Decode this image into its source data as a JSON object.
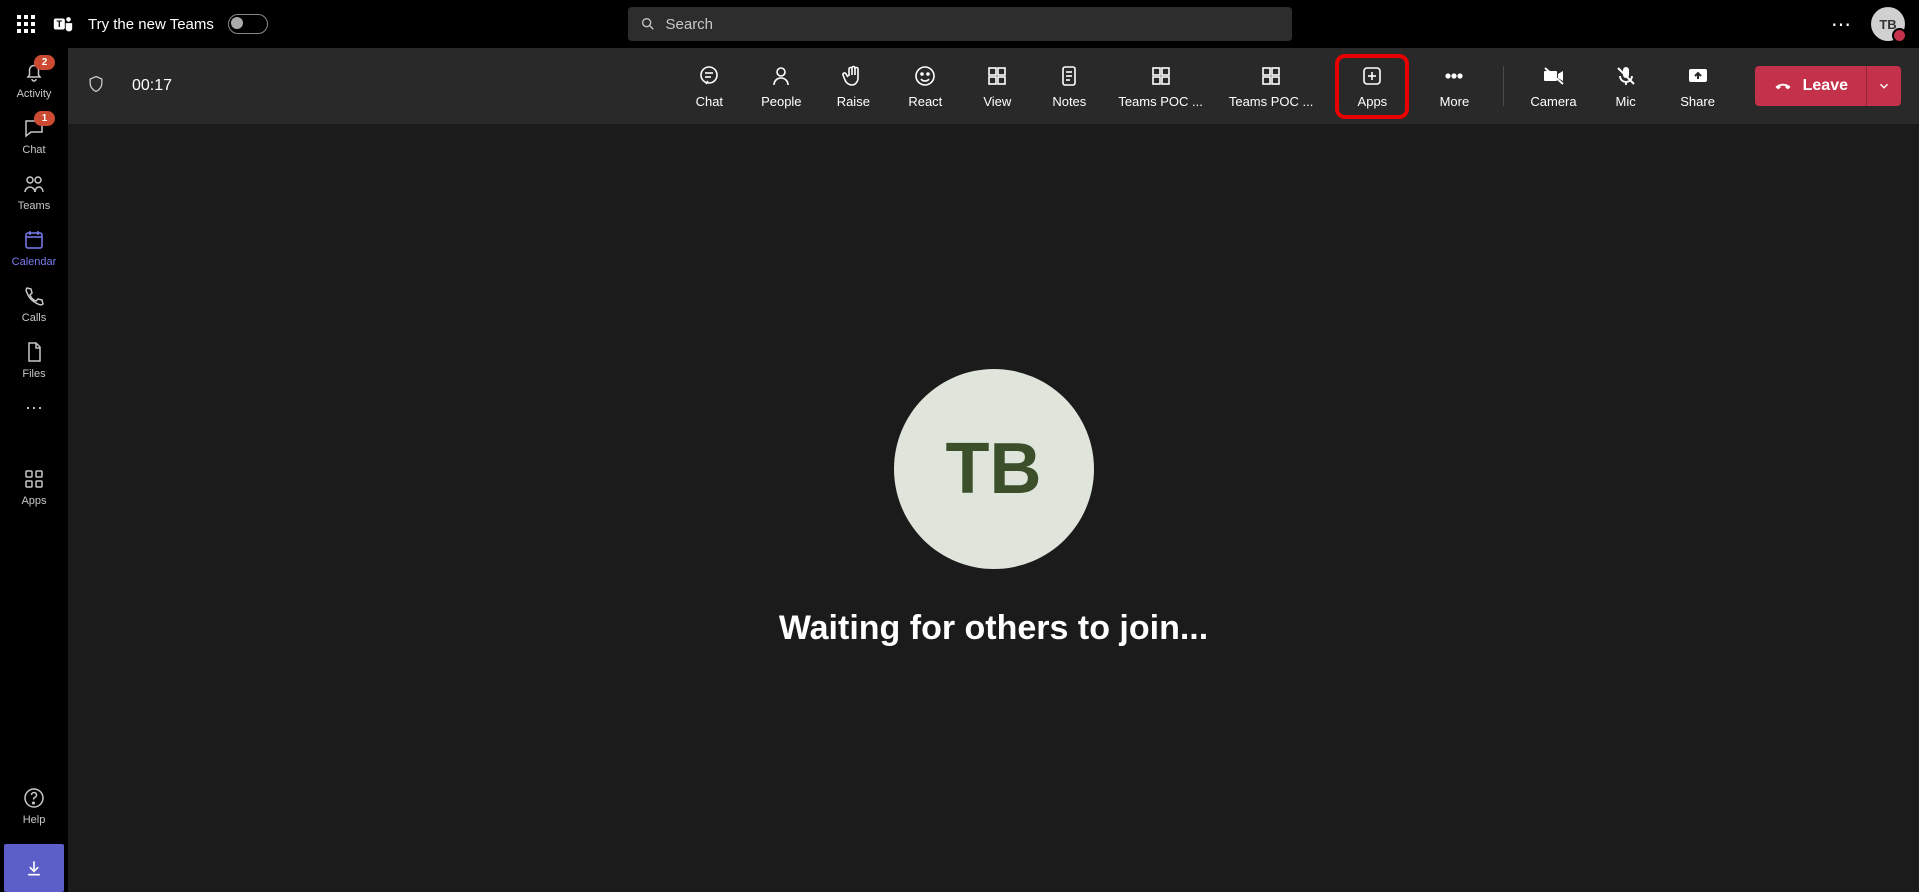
{
  "topbar": {
    "try_text": "Try the new Teams",
    "search_placeholder": "Search",
    "profile_initials": "TB"
  },
  "leftrail": {
    "items": [
      {
        "id": "activity",
        "label": "Activity",
        "badge": "2"
      },
      {
        "id": "chat",
        "label": "Chat",
        "badge": "1"
      },
      {
        "id": "teams",
        "label": "Teams"
      },
      {
        "id": "calendar",
        "label": "Calendar",
        "active": true
      },
      {
        "id": "calls",
        "label": "Calls"
      },
      {
        "id": "files",
        "label": "Files"
      }
    ],
    "apps_label": "Apps",
    "help_label": "Help"
  },
  "meetingbar": {
    "timer": "00:17",
    "buttons": {
      "chat": "Chat",
      "people": "People",
      "raise": "Raise",
      "react": "React",
      "view": "View",
      "notes": "Notes",
      "poc1": "Teams POC ...",
      "poc2": "Teams POC ...",
      "apps": "Apps",
      "more": "More",
      "camera": "Camera",
      "mic": "Mic",
      "share": "Share",
      "leave": "Leave"
    }
  },
  "stage": {
    "avatar_initials": "TB",
    "waiting_text": "Waiting for others to join..."
  }
}
